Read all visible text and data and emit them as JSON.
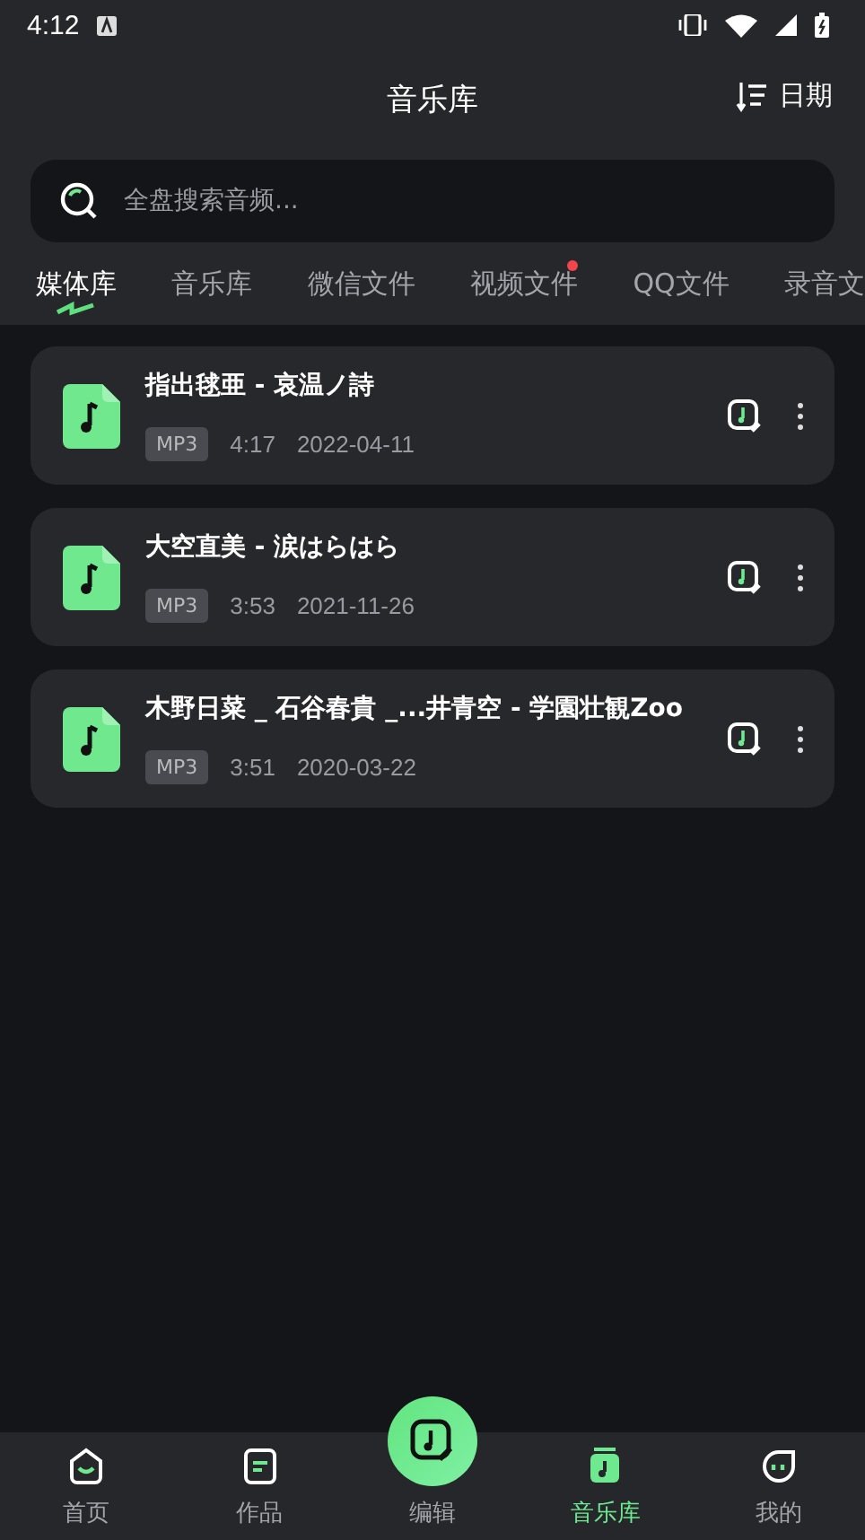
{
  "status_bar": {
    "time": "4:12"
  },
  "header": {
    "title": "音乐库",
    "sort_label": "日期"
  },
  "search": {
    "placeholder": "全盘搜索音频..."
  },
  "tabs": [
    {
      "label": "媒体库",
      "selected": true,
      "dot": false
    },
    {
      "label": "音乐库",
      "selected": false,
      "dot": false
    },
    {
      "label": "微信文件",
      "selected": false,
      "dot": false
    },
    {
      "label": "视频文件",
      "selected": false,
      "dot": true
    },
    {
      "label": "QQ文件",
      "selected": false,
      "dot": false
    },
    {
      "label": "录音文",
      "selected": false,
      "dot": false
    }
  ],
  "files": [
    {
      "title": "指出毬亜 - 哀温ノ詩",
      "format": "MP3",
      "duration": "4:17",
      "date": "2022-04-11"
    },
    {
      "title": "大空直美 - 涙はらはら",
      "format": "MP3",
      "duration": "3:53",
      "date": "2021-11-26"
    },
    {
      "title": "木野日菜 _ 石谷春貴 _...井青空 - 学園壮観Zoo",
      "format": "MP3",
      "duration": "3:51",
      "date": "2020-03-22"
    }
  ],
  "nav": [
    {
      "label": "首页",
      "kind": "home",
      "selected": false
    },
    {
      "label": "作品",
      "kind": "works",
      "selected": false
    },
    {
      "label": "编辑",
      "kind": "edit",
      "selected": false
    },
    {
      "label": "音乐库",
      "kind": "library",
      "selected": true
    },
    {
      "label": "我的",
      "kind": "me",
      "selected": false
    }
  ]
}
